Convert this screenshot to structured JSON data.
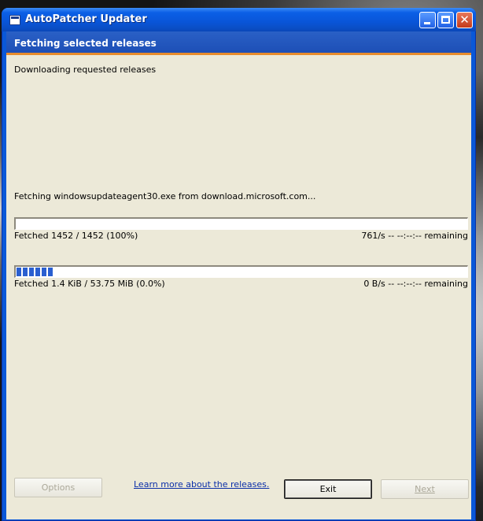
{
  "window": {
    "title": "AutoPatcher Updater"
  },
  "header": {
    "title": "Fetching selected releases"
  },
  "status": {
    "main": "Downloading requested releases",
    "fetching": "Fetching windowsupdateagent30.exe from download.microsoft.com..."
  },
  "overall": {
    "fetched_text": "Fetched 1452 / 1452 (100%)",
    "rate_text": "761/s -- --:--:-- remaining",
    "progress_fraction": 0.0
  },
  "file": {
    "fetched_text": "Fetched 1.4 KiB / 53.75 MiB (0.0%)",
    "rate_text": "0 B/s -- --:--:-- remaining",
    "progress_fraction": 0.08
  },
  "footer": {
    "options_label": "Options",
    "learn_more_label": "Learn more about the releases.",
    "exit_label": "Exit",
    "next_label": "Next"
  },
  "icons": {
    "app": "app-window-icon",
    "minimize": "minimize-icon",
    "maximize": "maximize-icon",
    "close": "close-icon"
  },
  "colors": {
    "title_blue": "#0955d8",
    "header_band": "#2a60c6",
    "accent_orange": "#e88c2c",
    "progress_blue": "#2a5fd0",
    "link_blue": "#0b2fa8"
  }
}
